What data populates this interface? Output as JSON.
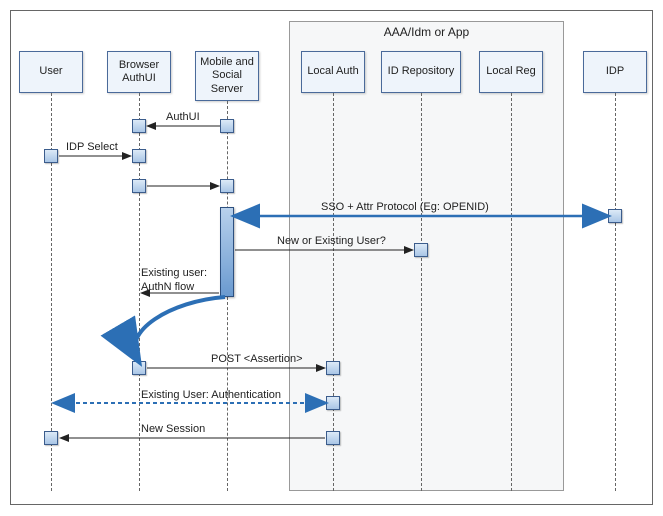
{
  "diagram": {
    "type": "sequence",
    "container_box": {
      "label": "AAA/Idm or App"
    },
    "participants": [
      {
        "id": "user",
        "label": "User"
      },
      {
        "id": "browser",
        "label": "Browser AuthUI"
      },
      {
        "id": "mss",
        "label": "Mobile and Social Server"
      },
      {
        "id": "localauth",
        "label": "Local Auth"
      },
      {
        "id": "idrepo",
        "label": "ID Repository"
      },
      {
        "id": "localreg",
        "label": "Local Reg"
      },
      {
        "id": "idp",
        "label": "IDP"
      }
    ],
    "messages": {
      "auth_ui": "AuthUI",
      "idp_select": "IDP Select",
      "sso_protocol": "SSO + Attr Protocol (Eg: OPENID)",
      "new_or_existing": "New or Existing User?",
      "existing_user_flow_l1": "Existing user:",
      "existing_user_flow_l2": "AuthN flow",
      "post_assertion": "POST <Assertion>",
      "existing_auth": "Existing User: Authentication",
      "new_session": "New Session"
    }
  }
}
